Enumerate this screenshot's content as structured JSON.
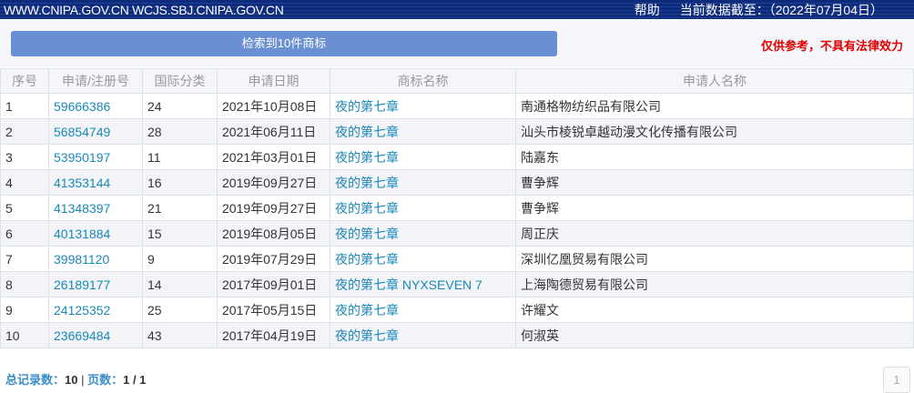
{
  "header": {
    "site": "WWW.CNIPA.GOV.CN WCJS.SBJ.CNIPA.GOV.CN",
    "help": "帮助",
    "date": "当前数据截至：（2022年07月04日）"
  },
  "panel": {
    "count": "检索到10件商标",
    "notice": "仅供参考，不具有法律效力"
  },
  "table": {
    "headers": [
      "序号",
      "申请/注册号",
      "国际分类",
      "申请日期",
      "商标名称",
      "申请人名称"
    ],
    "rows": [
      [
        "1",
        "59666386",
        "24",
        "2021年10月08日",
        "夜的第七章",
        "南通格物纺织品有限公司"
      ],
      [
        "2",
        "56854749",
        "28",
        "2021年06月11日",
        "夜的第七章",
        "汕头市棱锐卓越动漫文化传播有限公司"
      ],
      [
        "3",
        "53950197",
        "11",
        "2021年03月01日",
        "夜的第七章",
        "陆嘉东"
      ],
      [
        "4",
        "41353144",
        "16",
        "2019年09月27日",
        "夜的第七章",
        "曹争辉"
      ],
      [
        "5",
        "41348397",
        "21",
        "2019年09月27日",
        "夜的第七章",
        "曹争辉"
      ],
      [
        "6",
        "40131884",
        "15",
        "2019年08月05日",
        "夜的第七章",
        "周正庆"
      ],
      [
        "7",
        "39981120",
        "9",
        "2019年07月29日",
        "夜的第七章",
        "深圳亿凰贸易有限公司"
      ],
      [
        "8",
        "26189177",
        "14",
        "2017年09月01日",
        "夜的第七章 NYXSEVEN 7",
        "上海陶德贸易有限公司"
      ],
      [
        "9",
        "24125352",
        "25",
        "2017年05月15日",
        "夜的第七章",
        "许耀文"
      ],
      [
        "10",
        "23669484",
        "43",
        "2017年04月19日",
        "夜的第七章",
        "何淑英"
      ]
    ]
  },
  "footer": {
    "total_label": "总记录数：",
    "total": "10",
    "sep": " | ",
    "pages_label": "页数：",
    "pages": "1 / 1",
    "page_button": "1"
  }
}
